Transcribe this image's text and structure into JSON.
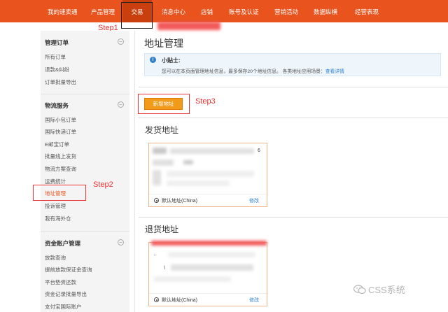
{
  "nav": {
    "items": [
      {
        "label": "我的速卖通"
      },
      {
        "label": "产品管理"
      },
      {
        "label": "交易"
      },
      {
        "label": "消息中心"
      },
      {
        "label": "店铺"
      },
      {
        "label": "账号及认证"
      },
      {
        "label": "营销活动"
      },
      {
        "label": "数据纵横"
      },
      {
        "label": "经营表现"
      }
    ]
  },
  "annotations": {
    "step1": "Step1",
    "step2": "Step2",
    "step3": "Step3"
  },
  "sidebar": {
    "sections": [
      {
        "title": "管理订单",
        "toggle": "−",
        "items": [
          "所有订单",
          "退款&纠纷",
          "订单批量导出"
        ]
      },
      {
        "title": "物流服务",
        "toggle": "−",
        "items": [
          "国际小包订单",
          "国际快递订单",
          "E邮宝订单",
          "批量线上发货",
          "物流方案查询",
          "运费统计",
          "地址管理",
          "投诉管理",
          "我有海外仓"
        ]
      },
      {
        "title": "资金账户管理",
        "toggle": "−",
        "items": [
          "放款查询",
          "提前放款保证金查询",
          "平台垫资还款",
          "资金记录批量导出",
          "支付宝国际账户"
        ]
      }
    ]
  },
  "main": {
    "title": "地址管理",
    "tip": {
      "title": "小贴士:",
      "text": "您可以在本页面管理地址信息，最多保存20个地址信息。 各类地址应用场景：",
      "link": "查看详情"
    },
    "add_button": "新增地址",
    "shipping": {
      "title": "发货地址",
      "card": {
        "fragment": "6",
        "default_label": "默认地址(China)",
        "edit": "修改"
      }
    },
    "returns": {
      "title": "退货地址",
      "card": {
        "fragment1": "-",
        "fragment2": "\\",
        "default_label": "默认地址(China)",
        "edit": "修改"
      }
    }
  },
  "watermark": "CSS系统",
  "colors": {
    "nav_bg": "#e8531e",
    "nav_active": "#c93f0d",
    "annotation": "#ee3333",
    "button": "#f29a1a",
    "link": "#2f80d0"
  }
}
